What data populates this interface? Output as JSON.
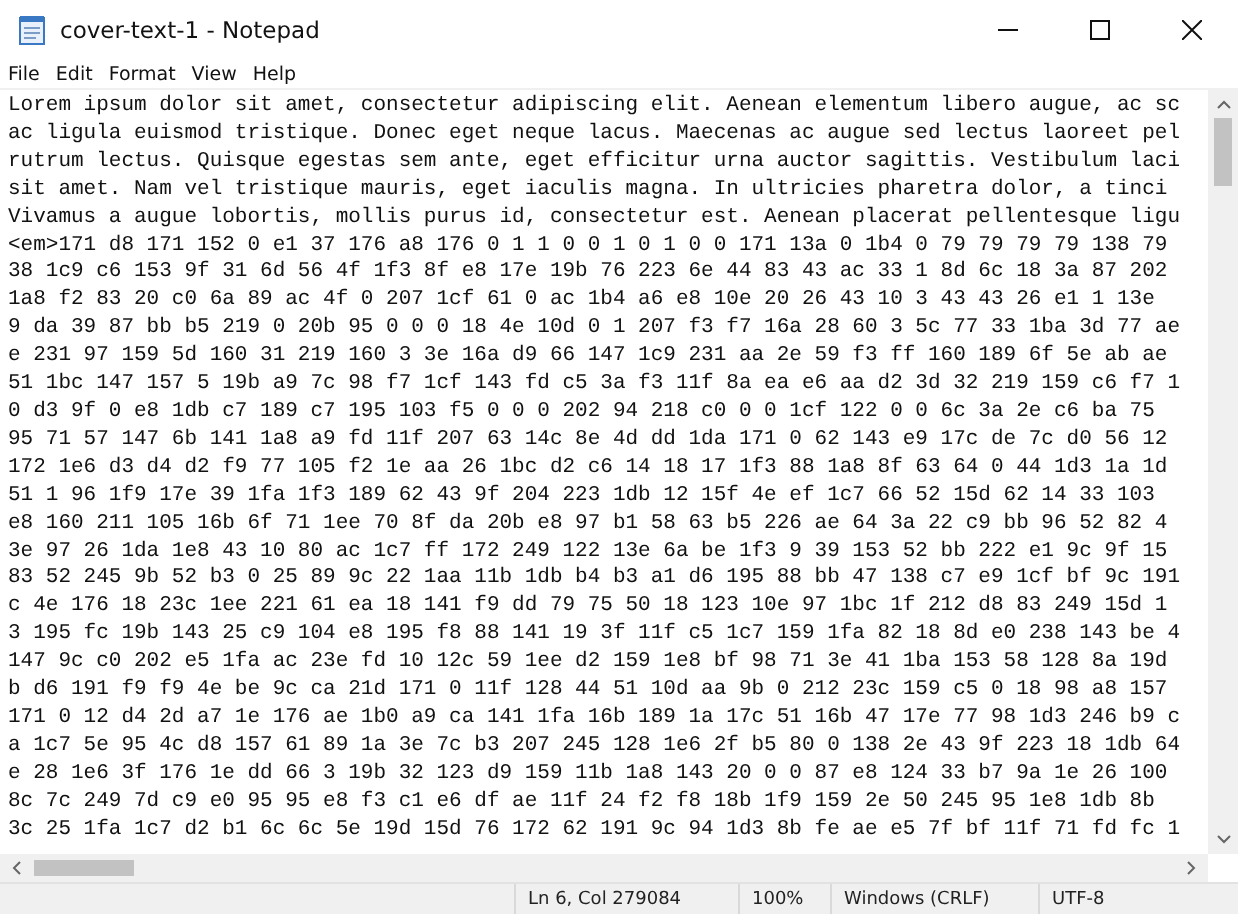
{
  "window": {
    "title": "cover-text-1 - Notepad"
  },
  "menu": [
    "File",
    "Edit",
    "Format",
    "View",
    "Help"
  ],
  "lines": [
    "Lorem ipsum dolor sit amet, consectetur adipiscing elit. Aenean elementum libero augue, ac sc",
    "ac ligula euismod tristique. Donec eget neque lacus. Maecenas ac augue sed lectus laoreet pel",
    "rutrum lectus. Quisque egestas sem ante, eget efficitur urna auctor sagittis. Vestibulum laci",
    "sit amet. Nam vel tristique mauris, eget iaculis magna. In ultricies pharetra dolor, a tinci",
    "Vivamus a augue lobortis, mollis purus id, consectetur est. Aenean placerat pellentesque ligu",
    "<em>171 d8 171 152 0 e1 37 176 a8 176 0 1 1 0 0 1 0 1 0 0 171 13a 0 1b4 0 79 79 79 79 138 79",
    "38 1c9 c6 153 9f 31 6d 56 4f 1f3 8f e8 17e 19b 76 223 6e 44 83 43 ac 33 1 8d 6c 18 3a 87 202",
    "1a8 f2 83 20 c0 6a 89 ac 4f 0 207 1cf 61 0 ac 1b4 a6 e8 10e 20 26 43 10 3 43 43 26 e1 1 13e",
    "9 da 39 87 bb b5 219 0 20b 95 0 0 0 18 4e 10d 0 1 207 f3 f7 16a 28 60 3 5c 77 33 1ba 3d 77 ae",
    "e 231 97 159 5d 160 31 219 160 3 3e 16a d9 66 147 1c9 231 aa 2e 59 f3 ff 160 189 6f 5e ab ae",
    "51 1bc 147 157 5 19b a9 7c 98 f7 1cf 143 fd c5 3a f3 11f 8a ea e6 aa d2 3d 32 219 159 c6 f7 1",
    "0 d3 9f 0 e8 1db c7 189 c7 195 103 f5 0 0 0 202 94 218 c0 0 0 1cf 122 0 0 6c 3a 2e c6 ba 75",
    "95 71 57 147 6b 141 1a8 a9 fd 11f 207 63 14c 8e 4d dd 1da 171 0 62 143 e9 17c de 7c d0 56 12",
    "172 1e6 d3 d4 d2 f9 77 105 f2 1e aa 26 1bc d2 c6 14 18 17 1f3 88 1a8 8f 63 64 0 44 1d3 1a 1d",
    "51 1 96 1f9 17e 39 1fa 1f3 189 62 43 9f 204 223 1db 12 15f 4e ef 1c7 66 52 15d 62 14 33 103",
    "e8 160 211 105 16b 6f 71 1ee 70 8f da 20b e8 97 b1 58 63 b5 226 ae 64 3a 22 c9 bb 96 52 82 4",
    "3e 97 26 1da 1e8 43 10 80 ac 1c7 ff 172 249 122 13e 6a be 1f3 9 39 153 52 bb 222 e1 9c 9f 15",
    "83 52 245 9b 52 b3 0 25 89 9c 22 1aa 11b 1db b4 b3 a1 d6 195 88 bb 47 138 c7 e9 1cf bf 9c 191",
    "c 4e 176 18 23c 1ee 221 61 ea 18 141 f9 dd 79 75 50 18 123 10e 97 1bc 1f 212 d8 83 249 15d 1",
    "3 195 fc 19b 143 25 c9 104 e8 195 f8 88 141 19 3f 11f c5 1c7 159 1fa 82 18 8d e0 238 143 be 4",
    "147 9c c0 202 e5 1fa ac 23e fd 10 12c 59 1ee d2 159 1e8 bf 98 71 3e 41 1ba 153 58 128 8a 19d",
    "b d6 191 f9 f9 4e be 9c ca 21d 171 0 11f 128 44 51 10d aa 9b 0 212 23c 159 c5 0 18 98 a8 157",
    "171 0 12 d4 2d a7 1e 176 ae 1b0 a9 ca 141 1fa 16b 189 1a 17c 51 16b 47 17e 77 98 1d3 246 b9 c",
    "a 1c7 5e 95 4c d8 157 61 89 1a 3e 7c b3 207 245 128 1e6 2f b5 80 0 138 2e 43 9f 223 18 1db 64",
    "e 28 1e6 3f 176 1e dd 66 3 19b 32 123 d9 159 11b 1a8 143 20 0 0 87 e8 124 33 b7 9a 1e 26 100",
    "8c 7c 249 7d c9 e0 95 95 e8 f3 c1 e6 df ae 11f 24 f2 f8 18b 1f9 159 2e 50 245 95 1e8 1db 8b",
    "3c 25 1fa 1c7 d2 b1 6c 6c 5e 19d 15d 76 172 62 191 9c 94 1d3 8b fe ae e5 7f bf 11f 71 fd fc 1"
  ],
  "status_bar": [
    "Ln 6, Col 279084",
    "100%",
    "Windows (CRLF)",
    "UTF-8"
  ]
}
